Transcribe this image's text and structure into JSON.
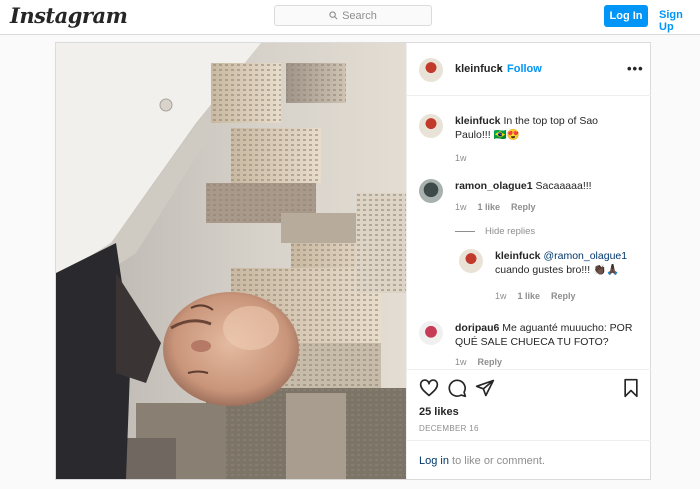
{
  "nav": {
    "logo": "Instagram",
    "search_placeholder": "Search",
    "login_label": "Log In",
    "signup_label": "Sign Up"
  },
  "post": {
    "username": "kleinfuck",
    "follow_separator": "•",
    "follow_label": "Follow",
    "more_label": "•••",
    "likes": "25 likes",
    "date": "DECEMBER 16",
    "login_link": "Log in",
    "login_suffix": " to like or comment."
  },
  "comments": [
    {
      "user": "kleinfuck",
      "text": "In the top top of Sao Paulo!!! 🇧🇷😍",
      "time": "1w"
    },
    {
      "user": "ramon_olague1",
      "text": "Sacaaaaa!!!",
      "time": "1w",
      "likes": "1 like",
      "reply": "Reply"
    },
    {
      "hide_replies": "Hide replies"
    },
    {
      "user": "kleinfuck",
      "mention": "@ramon_olague1",
      "text": "cuando gustes bro!!! 👏🏿🙏🏿",
      "time": "1w",
      "likes": "1 like",
      "reply": "Reply"
    },
    {
      "user": "doripau6",
      "text": "Me aguanté muuucho: POR QUÉ SALE CHUECA TU FOTO?",
      "time": "1w",
      "reply": "Reply"
    }
  ],
  "icons": {
    "heart": "heart-icon",
    "comment": "comment-icon",
    "share": "share-icon",
    "save": "bookmark-icon",
    "search": "search-icon",
    "more": "more-icon"
  },
  "colors": {
    "accent": "#0095f6",
    "link": "#00376b",
    "muted": "#8e8e8e",
    "border": "#dbdbdb"
  }
}
